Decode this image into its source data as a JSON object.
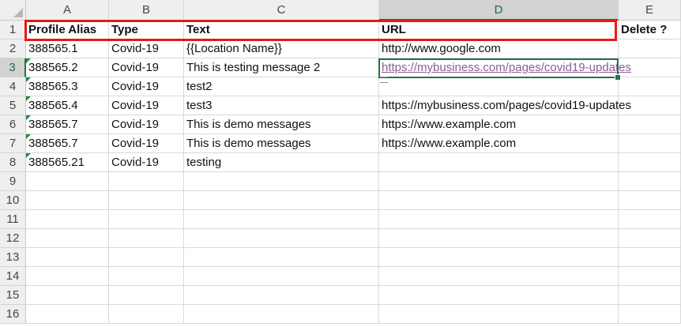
{
  "columns": [
    "A",
    "B",
    "C",
    "D",
    "E"
  ],
  "rows": [
    "1",
    "2",
    "3",
    "4",
    "5",
    "6",
    "7",
    "8",
    "9",
    "10",
    "11",
    "12",
    "13",
    "14",
    "15",
    "16"
  ],
  "selected_column": "D",
  "selected_row": "3",
  "header_row": {
    "profile_alias": "Profile Alias",
    "type": "Type",
    "text": "Text",
    "url": "URL",
    "delete": "Delete ?"
  },
  "data_rows": [
    {
      "alias": "388565.1",
      "type": "Covid-19",
      "text": "{{Location Name}}",
      "url": "http://www.google.com"
    },
    {
      "alias": "388565.2",
      "type": "Covid-19",
      "text": "This is testing message 2",
      "url": "https://mybusiness.com/pages/covid19-updates"
    },
    {
      "alias": "388565.3",
      "type": "Covid-19",
      "text": "test2",
      "url": ""
    },
    {
      "alias": "388565.4",
      "type": "Covid-19",
      "text": "test3",
      "url": "https://mybusiness.com/pages/covid19-updates"
    },
    {
      "alias": "388565.7",
      "type": "Covid-19",
      "text": "This is demo messages",
      "url": "https://www.example.com"
    },
    {
      "alias": "388565.7",
      "type": "Covid-19",
      "text": "This is demo messages",
      "url": "https://www.example.com"
    },
    {
      "alias": "388565.21",
      "type": "Covid-19",
      "text": "testing",
      "url": ""
    }
  ],
  "colors": {
    "excel_green": "#217346",
    "highlight_red": "#e81818",
    "visited_link": "#8e5a9a",
    "header_bg": "#efefef"
  }
}
